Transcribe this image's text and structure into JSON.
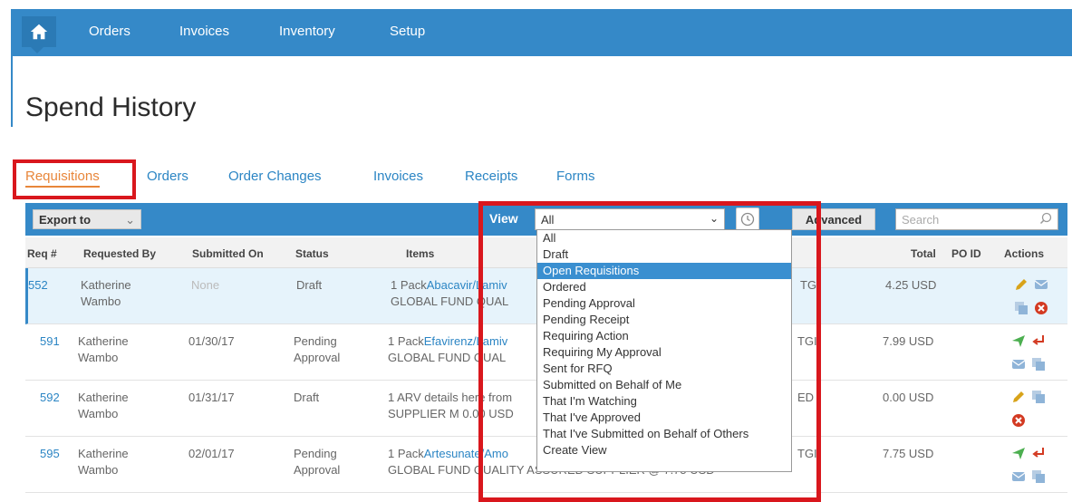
{
  "nav": {
    "items": [
      "Orders",
      "Invoices",
      "Inventory",
      "Setup"
    ]
  },
  "page": {
    "title": "Spend History"
  },
  "tabs": [
    "Requisitions",
    "Orders",
    "Order Changes",
    "Invoices",
    "Receipts",
    "Forms"
  ],
  "active_tab": "Requisitions",
  "toolbar": {
    "export_label": "Export to",
    "export_caret": "⌄",
    "view_label": "View",
    "view_value": "All",
    "advanced_label": "Advanced",
    "search_placeholder": "Search"
  },
  "table": {
    "headers": [
      "Req #",
      "Requested By",
      "Submitted On",
      "Status",
      "Items",
      "Total",
      "PO ID",
      "Actions"
    ],
    "rows": [
      {
        "req": "552",
        "by1": "Katherine",
        "by2": "Wambo",
        "submitted": "None",
        "status1": "Draft",
        "status2": "",
        "item_prefix": "1 Pack",
        "item_link": "Abacavir/Lamiv",
        "item_line2": "GLOBAL FUND QUAL",
        "item_tail": "TGI",
        "total": "4.25 USD"
      },
      {
        "req": "591",
        "by1": "Katherine",
        "by2": "Wambo",
        "submitted": "01/30/17",
        "status1": "Pending",
        "status2": "Approval",
        "item_prefix": "1 Pack",
        "item_link": "Efavirenz/Lamiv",
        "item_line2": "GLOBAL FUND QUAL",
        "item_tail": "TGI-",
        "total": "7.99 USD"
      },
      {
        "req": "592",
        "by1": "Katherine",
        "by2": "Wambo",
        "submitted": "01/31/17",
        "status1": "Draft",
        "status2": "",
        "item_prefix": "1 ARV details here from",
        "item_link": "",
        "item_line2": "SUPPLIER M 0.00 USD",
        "item_tail": "ED",
        "total": "0.00 USD"
      },
      {
        "req": "595",
        "by1": "Katherine",
        "by2": "Wambo",
        "submitted": "02/01/17",
        "status1": "Pending",
        "status2": "Approval",
        "item_prefix": "1 Pack",
        "item_link": "Artesunate/Amo",
        "item_line2": "GLOBAL FUND QUALITY ASSURED SUPPLIER @ 7.75 USD",
        "item_tail": "TGI",
        "total": "7.75 USD"
      }
    ]
  },
  "dropdown": {
    "options": [
      "All",
      "Draft",
      "Open Requisitions",
      "Ordered",
      "Pending Approval",
      "Pending Receipt",
      "Requiring Action",
      "Requiring My Approval",
      "Sent for RFQ",
      "Submitted on Behalf of Me",
      "That I'm Watching",
      "That I've Approved",
      "That I've Submitted on Behalf of Others",
      "Create View"
    ],
    "highlighted": "Open Requisitions"
  },
  "colors": {
    "nav_blue": "#3589c8",
    "highlight_red": "#d9171d",
    "active_tab_orange": "#e8863a",
    "link_blue": "#2b85c4"
  }
}
